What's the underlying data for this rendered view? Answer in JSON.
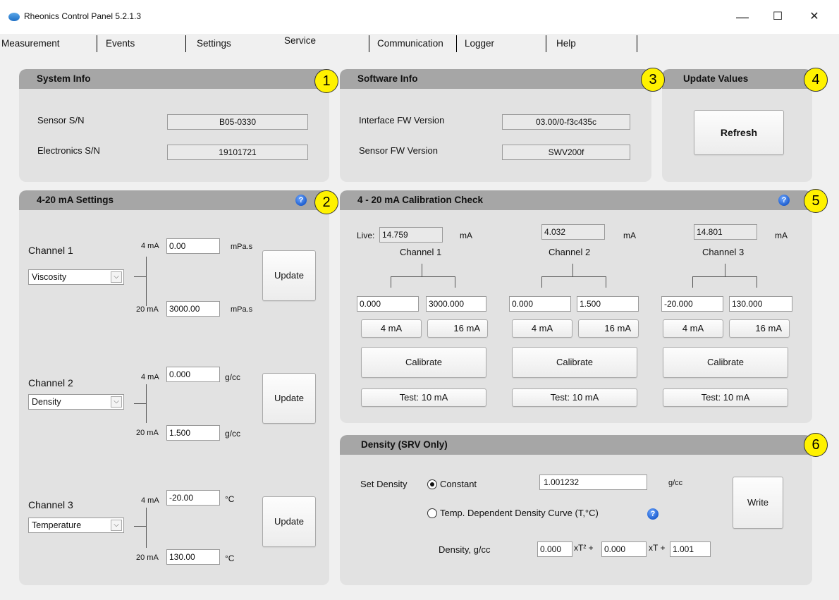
{
  "window": {
    "title": "Rheonics Control Panel 5.2.1.3",
    "minimize": "—",
    "maximize": "☐",
    "close": "✕"
  },
  "tabs": [
    "Measurement",
    "Events",
    "Settings",
    "Service",
    "Communication",
    "Logger",
    "Help"
  ],
  "active_tab": "Service",
  "badges": [
    "1",
    "2",
    "3",
    "4",
    "5",
    "6"
  ],
  "system_info": {
    "title": "System Info",
    "sensor_sn_label": "Sensor S/N",
    "sensor_sn": "B05-0330",
    "electronics_sn_label": "Electronics S/N",
    "electronics_sn": "19101721"
  },
  "software_info": {
    "title": "Software Info",
    "interface_fw_label": "Interface FW Version",
    "interface_fw": "03.00/0-f3c435c",
    "sensor_fw_label": "Sensor FW Version",
    "sensor_fw": "SWV200f"
  },
  "update_values": {
    "title": "Update Values",
    "refresh_label": "Refresh"
  },
  "ma_settings": {
    "title": "4-20 mA Settings",
    "help": "?",
    "low_label": "4 mA",
    "high_label": "20 mA",
    "update_label": "Update",
    "channels": [
      {
        "label": "Channel 1",
        "quantity": "Viscosity",
        "low": "0.00",
        "high": "3000.00",
        "unit": "mPa.s"
      },
      {
        "label": "Channel 2",
        "quantity": "Density",
        "low": "0.000",
        "high": "1.500",
        "unit": "g/cc"
      },
      {
        "label": "Channel 3",
        "quantity": "Temperature",
        "low": "-20.00",
        "high": "130.00",
        "unit": "°C"
      }
    ]
  },
  "calibration": {
    "title": "4 - 20 mA Calibration Check",
    "help": "?",
    "live_label": "Live:",
    "unit": "mA",
    "btn_4ma": "4 mA",
    "btn_16ma": "16 mA",
    "calibrate_label": "Calibrate",
    "test_label": "Test: 10 mA",
    "channels": [
      {
        "name": "Channel 1",
        "live": "14.759",
        "low": "0.000",
        "high": "3000.000"
      },
      {
        "name": "Channel 2",
        "live": "4.032",
        "low": "0.000",
        "high": "1.500"
      },
      {
        "name": "Channel 3",
        "live": "14.801",
        "low": "-20.000",
        "high": "130.000"
      }
    ]
  },
  "density": {
    "title": "Density (SRV Only)",
    "set_density_label": "Set Density",
    "constant_label": "Constant",
    "constant_value": "1.001232",
    "unit": "g/cc",
    "curve_label": "Temp. Dependent Density Curve (T,°C)",
    "help": "?",
    "density_label": "Density, g/cc",
    "coef_a": "0.000",
    "coef_b": "0.000",
    "coef_c": "1.001",
    "term_t2": "xT² +",
    "term_t": "xT +",
    "write_label": "Write",
    "selected_mode": "Constant"
  },
  "colors": {
    "panel_bg": "#e2e2e2",
    "header_bg": "#a6a6a6",
    "badge": "#fff200",
    "window_bg": "#f0f0f0"
  }
}
